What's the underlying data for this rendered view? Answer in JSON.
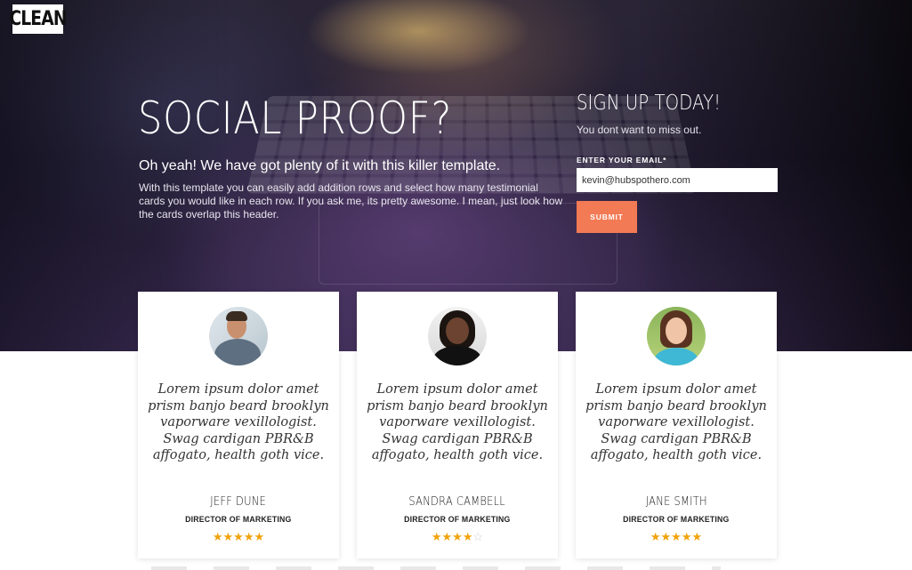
{
  "brand": {
    "logo": "CLEAN"
  },
  "hero": {
    "title": "SOCIAL PROOF?",
    "subtitle": "Oh yeah! We have got plenty of it with this killer template.",
    "body": "With this template you can easily add addition rows and select how many testimonial cards you would like in each row. If you ask me, its pretty awesome.  I mean, just look how the cards overlap this header."
  },
  "signup": {
    "title": "SIGN UP TODAY!",
    "subtitle": "You dont want to miss out.",
    "email_label": "ENTER YOUR EMAIL*",
    "email_value": "kevin@hubspothero.com",
    "submit_label": "SUBMIT",
    "button_color": "#f27a54"
  },
  "testimonials": [
    {
      "quote": "Lorem ipsum dolor amet prism banjo beard brooklyn vaporware vexillologist. Swag cardigan PBR&B affogato, health goth vice.",
      "name": "JEFF DUNE",
      "role": "DIRECTOR OF MARKETING",
      "rating": 5,
      "stars": "★★★★★",
      "stars_empty": ""
    },
    {
      "quote": "Lorem ipsum dolor amet prism banjo beard brooklyn vaporware vexillologist. Swag cardigan PBR&B affogato, health goth vice.",
      "name": "SANDRA CAMBELL",
      "role": "DIRECTOR OF MARKETING",
      "rating": 4,
      "stars": "★★★★",
      "stars_empty": "☆"
    },
    {
      "quote": "Lorem ipsum dolor amet prism banjo beard brooklyn vaporware vexillologist. Swag cardigan PBR&B affogato, health goth vice.",
      "name": "JANE SMITH",
      "role": "DIRECTOR OF MARKETING",
      "rating": 5,
      "stars": "★★★★★",
      "stars_empty": ""
    }
  ],
  "colors": {
    "star": "#f0a30a",
    "star_empty": "#cfcfcf"
  }
}
